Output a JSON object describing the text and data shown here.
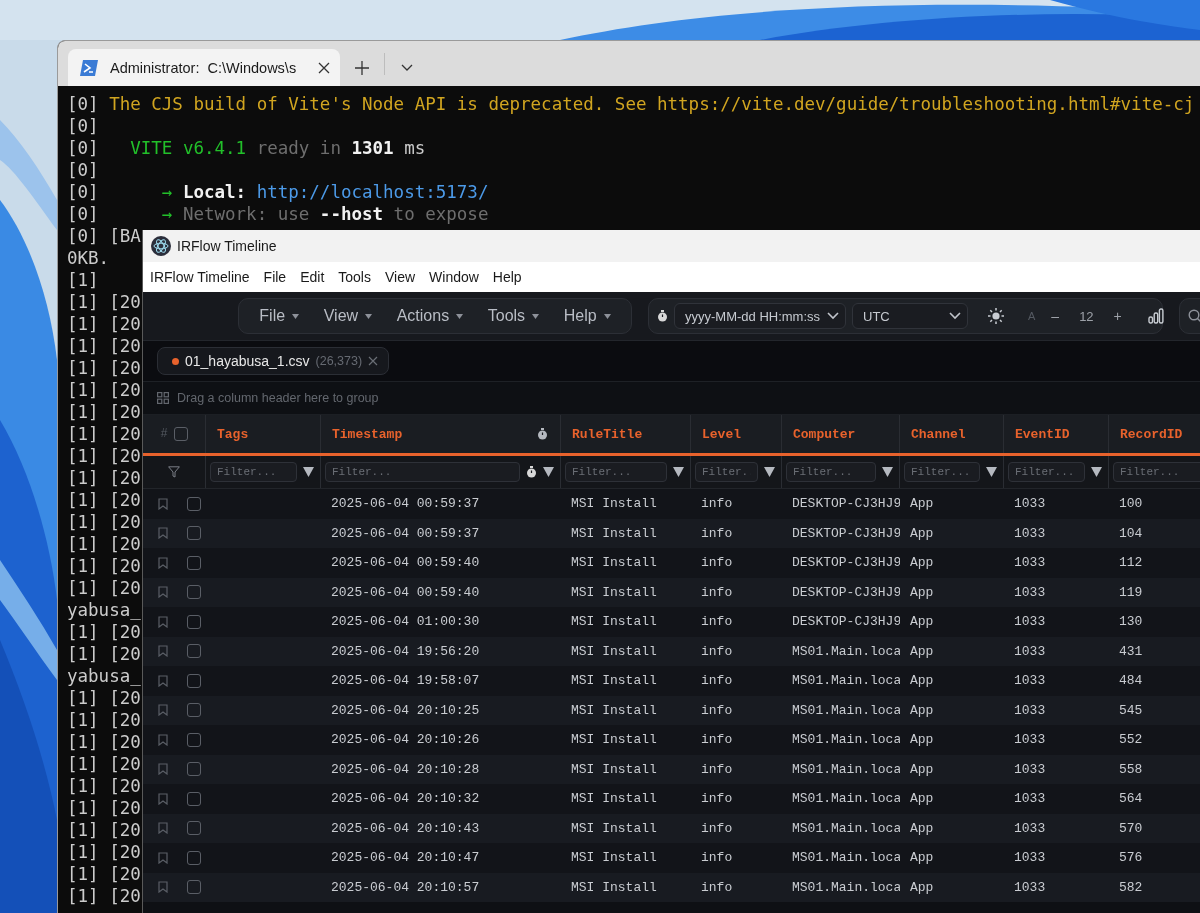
{
  "terminal": {
    "tabs": [
      {
        "title": "Administrator:  C:\\Windows\\s",
        "selected": true
      }
    ],
    "lines": [
      {
        "segments": [
          {
            "kind": "prefix",
            "text": "[0]"
          },
          {
            "kind": "warn",
            "text": "The CJS build of Vite's Node API is deprecated. See https://vite.dev/guide/troubleshooting.html#vite-cj"
          }
        ]
      },
      {
        "segments": [
          {
            "kind": "prefix",
            "text": "[0]"
          }
        ]
      },
      {
        "segments": [
          {
            "kind": "prefix",
            "text": "[0]"
          },
          {
            "kind": "vite",
            "text": "VITE v6.4.1"
          },
          {
            "kind": "dim",
            "text": "ready in"
          },
          {
            "kind": "bright",
            "text": "1301"
          },
          {
            "kind": "plain",
            "text": "ms"
          }
        ]
      },
      {
        "segments": [
          {
            "kind": "prefix",
            "text": "[0]"
          }
        ]
      },
      {
        "segments": [
          {
            "kind": "prefix",
            "text": "[0]"
          },
          {
            "kind": "arrow",
            "text": "→"
          },
          {
            "kind": "bright",
            "text": "Local:"
          },
          {
            "kind": "link",
            "text": "http://localhost:5173/"
          }
        ]
      },
      {
        "segments": [
          {
            "kind": "prefix",
            "text": "[0]"
          },
          {
            "kind": "arrow",
            "text": "→"
          },
          {
            "kind": "dim",
            "text": "Network: use"
          },
          {
            "kind": "bright",
            "text": "--host"
          },
          {
            "kind": "dim",
            "text": "to expose"
          }
        ]
      },
      {
        "segments": [
          {
            "kind": "prefix",
            "text": "[0]"
          },
          {
            "kind": "plain",
            "text": "[BA"
          }
        ]
      },
      {
        "segments": [
          {
            "kind": "plain",
            "text": "0KB."
          }
        ]
      },
      {
        "segments": [
          {
            "kind": "prefix",
            "text": "[1]"
          }
        ]
      },
      {
        "segments": [
          {
            "kind": "prefix",
            "text": "[1]"
          },
          {
            "kind": "plain",
            "text": "[20"
          }
        ]
      },
      {
        "segments": [
          {
            "kind": "prefix",
            "text": "[1]"
          },
          {
            "kind": "plain",
            "text": "[20"
          }
        ]
      },
      {
        "segments": [
          {
            "kind": "prefix",
            "text": "[1]"
          },
          {
            "kind": "plain",
            "text": "[20"
          }
        ]
      },
      {
        "segments": [
          {
            "kind": "prefix",
            "text": "[1]"
          },
          {
            "kind": "plain",
            "text": "[20"
          }
        ]
      },
      {
        "segments": [
          {
            "kind": "prefix",
            "text": "[1]"
          },
          {
            "kind": "plain",
            "text": "[20"
          }
        ]
      },
      {
        "segments": [
          {
            "kind": "prefix",
            "text": "[1]"
          },
          {
            "kind": "plain",
            "text": "[20"
          }
        ]
      },
      {
        "segments": [
          {
            "kind": "prefix",
            "text": "[1]"
          },
          {
            "kind": "plain",
            "text": "[20"
          }
        ]
      },
      {
        "segments": [
          {
            "kind": "prefix",
            "text": "[1]"
          },
          {
            "kind": "plain",
            "text": "[20"
          }
        ]
      },
      {
        "segments": [
          {
            "kind": "prefix",
            "text": "[1]"
          },
          {
            "kind": "plain",
            "text": "[20"
          }
        ]
      },
      {
        "segments": [
          {
            "kind": "prefix",
            "text": "[1]"
          },
          {
            "kind": "plain",
            "text": "[20"
          }
        ]
      },
      {
        "segments": [
          {
            "kind": "prefix",
            "text": "[1]"
          },
          {
            "kind": "plain",
            "text": "[20"
          }
        ]
      },
      {
        "segments": [
          {
            "kind": "prefix",
            "text": "[1]"
          },
          {
            "kind": "plain",
            "text": "[20"
          }
        ]
      },
      {
        "segments": [
          {
            "kind": "prefix",
            "text": "[1]"
          },
          {
            "kind": "plain",
            "text": "[20"
          }
        ]
      },
      {
        "segments": [
          {
            "kind": "prefix",
            "text": "[1]"
          },
          {
            "kind": "plain",
            "text": "[20"
          }
        ]
      },
      {
        "segments": [
          {
            "kind": "plain",
            "text": "yabusa_"
          }
        ]
      },
      {
        "segments": [
          {
            "kind": "prefix",
            "text": "[1]"
          },
          {
            "kind": "plain",
            "text": "[20"
          }
        ]
      },
      {
        "segments": [
          {
            "kind": "prefix",
            "text": "[1]"
          },
          {
            "kind": "plain",
            "text": "[20"
          }
        ]
      },
      {
        "segments": [
          {
            "kind": "plain",
            "text": "yabusa_"
          }
        ]
      },
      {
        "segments": [
          {
            "kind": "prefix",
            "text": "[1]"
          },
          {
            "kind": "plain",
            "text": "[20"
          }
        ]
      },
      {
        "segments": [
          {
            "kind": "prefix",
            "text": "[1]"
          },
          {
            "kind": "plain",
            "text": "[20"
          }
        ]
      },
      {
        "segments": [
          {
            "kind": "prefix",
            "text": "[1]"
          },
          {
            "kind": "plain",
            "text": "[20"
          }
        ]
      },
      {
        "segments": [
          {
            "kind": "prefix",
            "text": "[1]"
          },
          {
            "kind": "plain",
            "text": "[20"
          }
        ]
      },
      {
        "segments": [
          {
            "kind": "prefix",
            "text": "[1]"
          },
          {
            "kind": "plain",
            "text": "[20"
          }
        ]
      },
      {
        "segments": [
          {
            "kind": "prefix",
            "text": "[1]"
          },
          {
            "kind": "plain",
            "text": "[20"
          }
        ]
      },
      {
        "segments": [
          {
            "kind": "prefix",
            "text": "[1]"
          },
          {
            "kind": "plain",
            "text": "[20"
          }
        ]
      },
      {
        "segments": [
          {
            "kind": "prefix",
            "text": "[1]"
          },
          {
            "kind": "plain",
            "text": "[20"
          }
        ]
      },
      {
        "segments": [
          {
            "kind": "prefix",
            "text": "[1]"
          },
          {
            "kind": "plain",
            "text": "[20"
          }
        ]
      },
      {
        "segments": [
          {
            "kind": "prefix",
            "text": "[1]"
          },
          {
            "kind": "plain",
            "text": "[20"
          }
        ]
      }
    ]
  },
  "app": {
    "window_title": "IRFlow Timeline",
    "menu_bar": [
      "IRFlow Timeline",
      "File",
      "Edit",
      "Tools",
      "View",
      "Window",
      "Help"
    ],
    "toolbar_menus": [
      "File",
      "View",
      "Actions",
      "Tools",
      "Help"
    ],
    "date_format": "yyyy-MM-dd HH:mm:ss",
    "timezone": "UTC",
    "font_label": "A",
    "font_decrease": "–",
    "font_size": "12",
    "font_increase": "+",
    "file_tab": {
      "name": "01_hayabusa_1.csv",
      "count": "(26,373)"
    },
    "group_hint": "Drag a column header here to group",
    "table": {
      "index_header": "#",
      "select_all_checked": false,
      "columns": [
        {
          "label": "Tags",
          "placeholder": "Filter..."
        },
        {
          "label": "Timestamp",
          "placeholder": "Filter...",
          "kind": "time"
        },
        {
          "label": "RuleTitle",
          "placeholder": "Filter..."
        },
        {
          "label": "Level",
          "placeholder": "Filter.."
        },
        {
          "label": "Computer",
          "placeholder": "Filter..."
        },
        {
          "label": "Channel",
          "placeholder": "Filter..."
        },
        {
          "label": "EventID",
          "placeholder": "Filter..."
        },
        {
          "label": "RecordID",
          "placeholder": "Filter..."
        }
      ],
      "rows": [
        {
          "bookmarked": false,
          "checked": false,
          "cells": [
            "",
            "2025-06-04 00:59:37",
            "MSI Install",
            "info",
            "DESKTOP-CJ3HJ9",
            "App",
            "1033",
            "100"
          ]
        },
        {
          "bookmarked": false,
          "checked": false,
          "cells": [
            "",
            "2025-06-04 00:59:37",
            "MSI Install",
            "info",
            "DESKTOP-CJ3HJ9",
            "App",
            "1033",
            "104"
          ]
        },
        {
          "bookmarked": false,
          "checked": false,
          "cells": [
            "",
            "2025-06-04 00:59:40",
            "MSI Install",
            "info",
            "DESKTOP-CJ3HJ9",
            "App",
            "1033",
            "112"
          ]
        },
        {
          "bookmarked": false,
          "checked": false,
          "cells": [
            "",
            "2025-06-04 00:59:40",
            "MSI Install",
            "info",
            "DESKTOP-CJ3HJ9",
            "App",
            "1033",
            "119"
          ]
        },
        {
          "bookmarked": false,
          "checked": false,
          "cells": [
            "",
            "2025-06-04 01:00:30",
            "MSI Install",
            "info",
            "DESKTOP-CJ3HJ9",
            "App",
            "1033",
            "130"
          ]
        },
        {
          "bookmarked": false,
          "checked": false,
          "cells": [
            "",
            "2025-06-04 19:56:20",
            "MSI Install",
            "info",
            "MS01.Main.loca",
            "App",
            "1033",
            "431"
          ]
        },
        {
          "bookmarked": false,
          "checked": false,
          "cells": [
            "",
            "2025-06-04 19:58:07",
            "MSI Install",
            "info",
            "MS01.Main.loca",
            "App",
            "1033",
            "484"
          ]
        },
        {
          "bookmarked": false,
          "checked": false,
          "cells": [
            "",
            "2025-06-04 20:10:25",
            "MSI Install",
            "info",
            "MS01.Main.loca",
            "App",
            "1033",
            "545"
          ]
        },
        {
          "bookmarked": false,
          "checked": false,
          "cells": [
            "",
            "2025-06-04 20:10:26",
            "MSI Install",
            "info",
            "MS01.Main.loca",
            "App",
            "1033",
            "552"
          ]
        },
        {
          "bookmarked": false,
          "checked": false,
          "cells": [
            "",
            "2025-06-04 20:10:28",
            "MSI Install",
            "info",
            "MS01.Main.loca",
            "App",
            "1033",
            "558"
          ]
        },
        {
          "bookmarked": false,
          "checked": false,
          "cells": [
            "",
            "2025-06-04 20:10:32",
            "MSI Install",
            "info",
            "MS01.Main.loca",
            "App",
            "1033",
            "564"
          ]
        },
        {
          "bookmarked": false,
          "checked": false,
          "cells": [
            "",
            "2025-06-04 20:10:43",
            "MSI Install",
            "info",
            "MS01.Main.loca",
            "App",
            "1033",
            "570"
          ]
        },
        {
          "bookmarked": false,
          "checked": false,
          "cells": [
            "",
            "2025-06-04 20:10:47",
            "MSI Install",
            "info",
            "MS01.Main.loca",
            "App",
            "1033",
            "576"
          ]
        },
        {
          "bookmarked": false,
          "checked": false,
          "cells": [
            "",
            "2025-06-04 20:10:57",
            "MSI Install",
            "info",
            "MS01.Main.loca",
            "App",
            "1033",
            "582"
          ]
        }
      ]
    }
  }
}
